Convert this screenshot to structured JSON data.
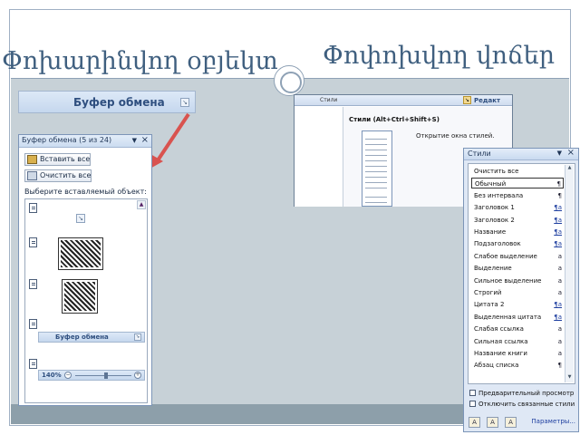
{
  "slide": {
    "title_left": "Փոխարինվող օբյեկտ",
    "title_right": "Փոփոխվող վոճեր"
  },
  "clipboard_ribbon": {
    "label": "Буфер обмена"
  },
  "clipboard_pane": {
    "title": "Буфер обмена (5 из 24)",
    "paste_all": "Вставить все",
    "clear_all": "Очистить все",
    "hint": "Выберите вставляемый объект:",
    "mini_ribbon_label": "Буфер обмена",
    "zoom": "140%"
  },
  "word_window": {
    "tab_styles": "Стили",
    "tab_editing": "Редакт",
    "tooltip_title": "Стили (Alt+Ctrl+Shift+S)",
    "tooltip_text": "Открытие окна стилей."
  },
  "styles_pane": {
    "title": "Стили",
    "items": [
      {
        "label": "Очистить все",
        "mark": ""
      },
      {
        "label": "Обычный",
        "mark": "¶"
      },
      {
        "label": "Без интервала",
        "mark": "¶"
      },
      {
        "label": "Заголовок 1",
        "mark": "¶a"
      },
      {
        "label": "Заголовок 2",
        "mark": "¶a"
      },
      {
        "label": "Название",
        "mark": "¶a"
      },
      {
        "label": "Подзаголовок",
        "mark": "¶a"
      },
      {
        "label": "Слабое выделение",
        "mark": "a"
      },
      {
        "label": "Выделение",
        "mark": "a"
      },
      {
        "label": "Сильное выделение",
        "mark": "a"
      },
      {
        "label": "Строгий",
        "mark": "a"
      },
      {
        "label": "Цитата 2",
        "mark": "¶a"
      },
      {
        "label": "Выделенная цитата",
        "mark": "¶a"
      },
      {
        "label": "Слабая ссылка",
        "mark": "a"
      },
      {
        "label": "Сильная ссылка",
        "mark": "a"
      },
      {
        "label": "Название книги",
        "mark": "a"
      },
      {
        "label": "Абзац списка",
        "mark": "¶"
      }
    ],
    "preview_label": "Предварительный просмотр",
    "linked_label": "Отключить связанные стили",
    "options_link": "Параметры..."
  }
}
